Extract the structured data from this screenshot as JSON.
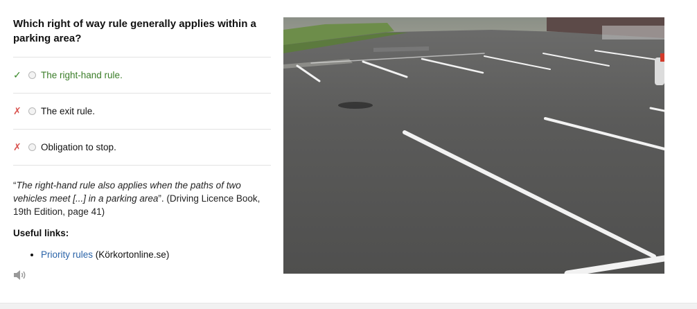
{
  "question": "Which right of way rule generally applies within a parking area?",
  "answers": [
    {
      "label": "The right-hand rule.",
      "mark": "✓",
      "status": "correct"
    },
    {
      "label": "The exit rule.",
      "mark": "✗",
      "status": "incorrect"
    },
    {
      "label": "Obligation to stop.",
      "mark": "✗",
      "status": "incorrect"
    }
  ],
  "explanation": {
    "open_quote": "“",
    "quote_italic": "The right-hand rule also applies when the paths of two vehicles meet [...] in a parking area",
    "close_and_source": "”. (Driving Licence Book, 19th Edition, page 41)"
  },
  "useful_links": {
    "title": "Useful links:",
    "items": [
      {
        "link_text": "Priority rules",
        "suffix": " (Körkortonline.se)"
      }
    ]
  },
  "icons": {
    "correct": "check-icon",
    "incorrect": "cross-icon",
    "audio": "speaker-icon"
  },
  "colors": {
    "correct": "#3a7d28",
    "incorrect": "#d9534f",
    "link": "#2a63a8"
  }
}
